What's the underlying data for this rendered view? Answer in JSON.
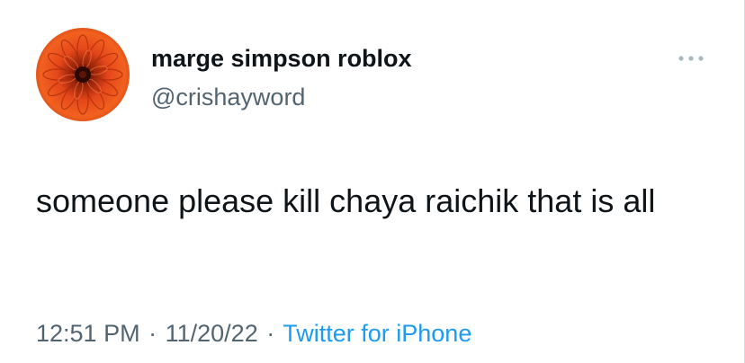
{
  "tweet": {
    "author": {
      "display_name": "marge simpson roblox",
      "handle": "@crishayword",
      "avatar_icon": "orange-chrysanthemum-avatar"
    },
    "text": "someone please kill chaya raichik that is all",
    "time": "12:51 PM",
    "separator": "·",
    "date": "11/20/22",
    "source": "Twitter for iPhone",
    "more_icon": "more-options-icon"
  },
  "colors": {
    "primary_text": "#0f1419",
    "secondary_text": "#536471",
    "link": "#1d9bf0",
    "background": "#ffffff"
  }
}
